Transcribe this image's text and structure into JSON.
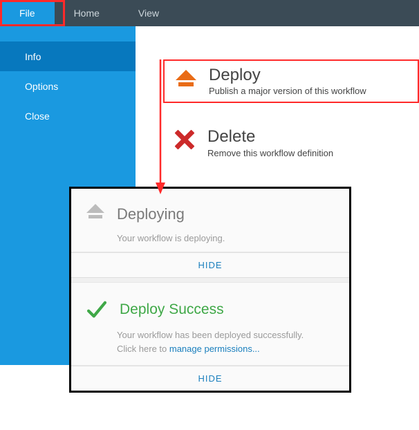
{
  "topbar": {
    "tabs": [
      {
        "label": "File",
        "active": true
      },
      {
        "label": "Home",
        "active": false
      },
      {
        "label": "View",
        "active": false
      }
    ]
  },
  "sidebar": {
    "items": [
      {
        "label": "Info",
        "active": true
      },
      {
        "label": "Options",
        "active": false
      },
      {
        "label": "Close",
        "active": false
      }
    ]
  },
  "actions": {
    "deploy": {
      "title": "Deploy",
      "subtitle": "Publish a major version of this workflow"
    },
    "delete": {
      "title": "Delete",
      "subtitle": "Remove this workflow definition"
    }
  },
  "status": {
    "deploying": {
      "title": "Deploying",
      "message": "Your workflow is deploying.",
      "hide": "HIDE"
    },
    "success": {
      "title": "Deploy Success",
      "message_pre": "Your workflow has been deployed successfully. Click here to ",
      "link": "manage permissions...",
      "hide": "HIDE"
    }
  }
}
